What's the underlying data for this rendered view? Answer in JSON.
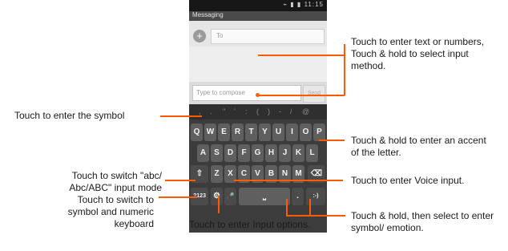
{
  "status_bar": {
    "time": "11:15"
  },
  "app": {
    "title": "Messaging"
  },
  "to_field": {
    "placeholder": "To"
  },
  "compose": {
    "placeholder": "Type to compose",
    "send_label": "Send"
  },
  "keyboard": {
    "symbols": [
      ",",
      ".",
      "\"",
      "'",
      ":",
      "(",
      ")",
      "-",
      "/",
      "@"
    ],
    "row1": [
      "Q",
      "W",
      "E",
      "R",
      "T",
      "Y",
      "U",
      "I",
      "O",
      "P"
    ],
    "row2": [
      "A",
      "S",
      "D",
      "F",
      "G",
      "H",
      "J",
      "K",
      "L"
    ],
    "row3_letters": [
      "Z",
      "X",
      "C",
      "V",
      "B",
      "N",
      "M"
    ],
    "shift_label": "⇧",
    "delete_label": "⌫",
    "sym_label": "?123",
    "settings_label": "⚙",
    "mic_label": "🎤",
    "space_label": "⎵",
    "period_label": ".",
    "smiley_label": ":-)"
  },
  "annotations": {
    "text_input": "Touch to enter text or numbers, Touch & hold to select input method.",
    "symbol": "Touch to enter the symbol",
    "accent": "Touch & hold to enter an accent of the letter.",
    "abc_mode": "Touch to switch \"abc/ Abc/ABC\" input mode",
    "voice": "Touch to enter Voice input.",
    "numeric": "Touch to switch to symbol and numeric keyboard",
    "input_options": "Touch to enter Input options.",
    "emotion": "Touch & hold, then select to enter symbol/ emotion."
  },
  "colors": {
    "annotation_line": "#ff5a00",
    "keyboard_bg": "#3c3c3c",
    "key": "#5f5f5f"
  }
}
